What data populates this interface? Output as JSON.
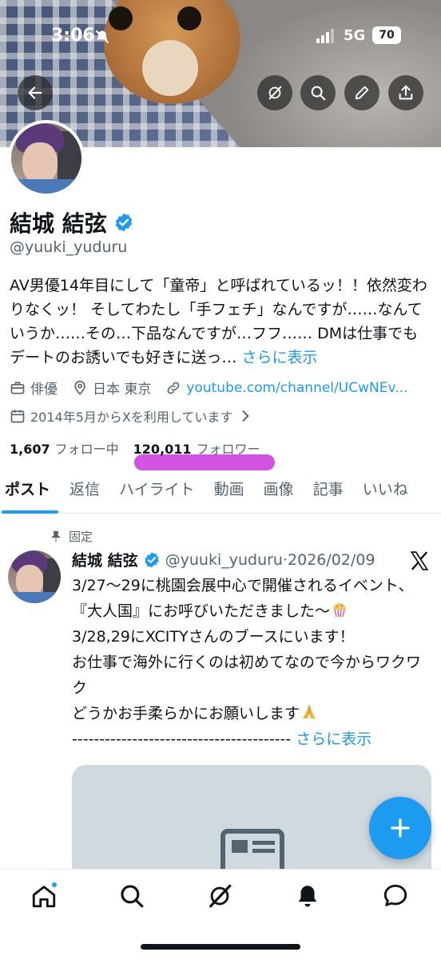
{
  "status_bar": {
    "time": "3:06",
    "network": "5G",
    "battery": "70"
  },
  "icons": {
    "back": "back-arrow-icon",
    "grok": "grok-icon",
    "search": "search-icon",
    "edit": "pencil-icon",
    "share": "share-icon",
    "verified": "verified-badge-icon"
  },
  "profile": {
    "name": "結城 結弦",
    "handle": "@yuuki_yuduru",
    "bio": "AV男優14年目にして「童帝」と呼ばれているッ！！依然変わりなくッ！ そしてわたし「手フェチ」なんですが……なんていうか……その…下品なんですが…フフ…… DMは仕事でもデートのお誘いでも好きに送っ…",
    "bio_more": " さらに表示",
    "profession": "俳優",
    "location": "日本 東京",
    "link": "youtube.com/channel/UCwNEv...",
    "joined": "2014年5月からXを利用しています",
    "following_count": "1,607",
    "following_label": "フォロー中",
    "followers_count": "120,011",
    "followers_label": "フォロワー"
  },
  "tabs": [
    {
      "label": "ポスト",
      "active": true
    },
    {
      "label": "返信"
    },
    {
      "label": "ハイライト"
    },
    {
      "label": "動画"
    },
    {
      "label": "画像"
    },
    {
      "label": "記事"
    },
    {
      "label": "いいね"
    }
  ],
  "post": {
    "pinned_label": "固定",
    "author": "結城 結弦",
    "handle_date": "@yuuki_yuduru·2026/02/09",
    "line1": "3/27〜29に桃園会展中心で開催されるイベント、『大人国』にお呼びいただきました〜",
    "line2": "3/28,29にXCITYさんのブースにいます！",
    "line3": "お仕事で海外に行くのは初めてなので今からワクワク",
    "line4": "どうかお手柔らかにお願いします",
    "line5": "----------------------------------------",
    "more": " さらに表示"
  },
  "colors": {
    "accent": "#1d9bf0",
    "text": "#0f1419",
    "muted": "#536471",
    "highlight": "#cc3fe0"
  }
}
